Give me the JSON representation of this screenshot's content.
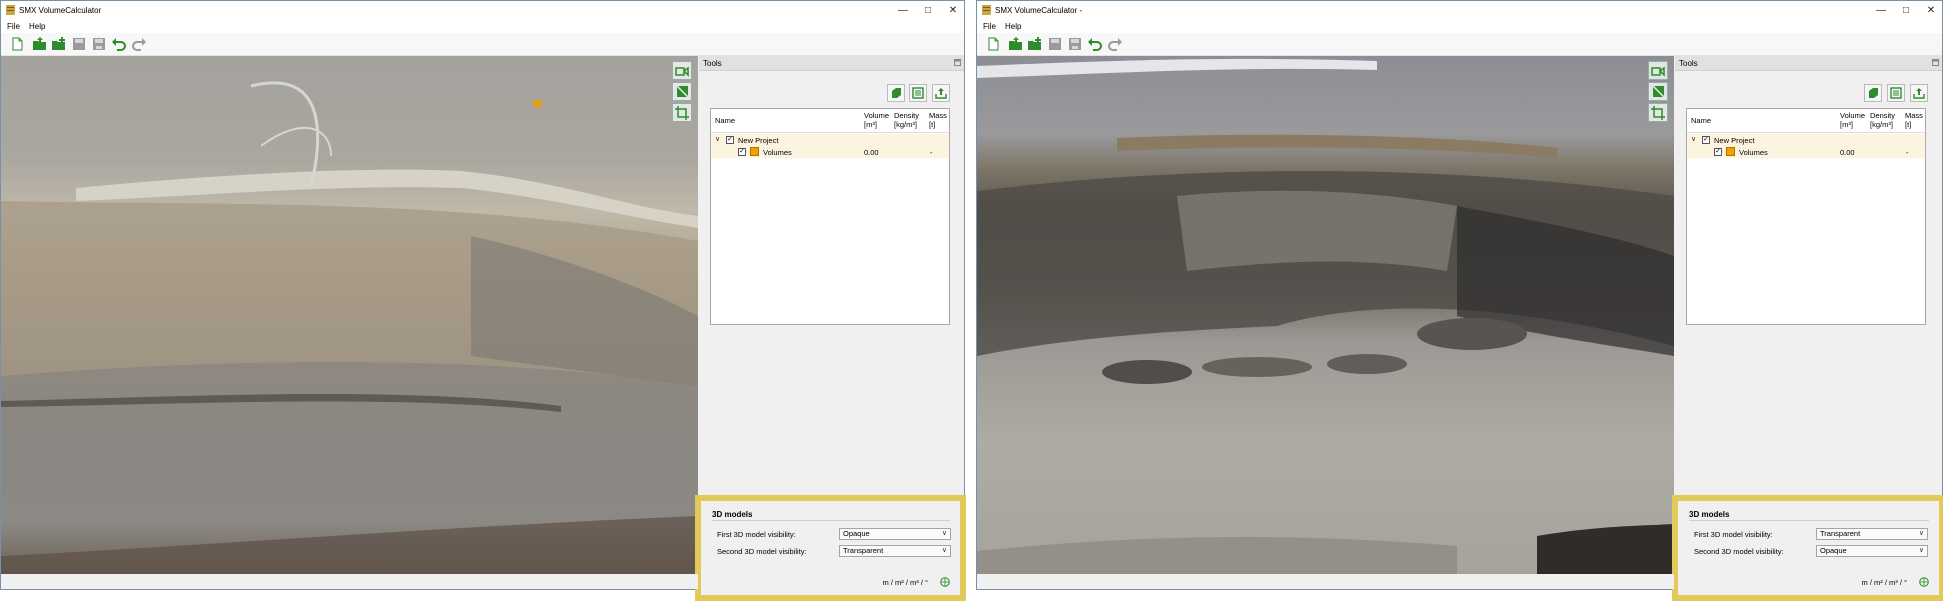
{
  "colors": {
    "accent_green": "#2e8b2e",
    "highlight_border": "#e1c95a",
    "row_highlight": "#fdf3e1",
    "volume_swatch": "#f2a000"
  },
  "windows": [
    {
      "title": "SMX VolumeCalculator",
      "menu": [
        "File",
        "Help"
      ],
      "toolbar_icons": [
        "new-file-icon",
        "open-folder-icon",
        "open-folder-add-icon",
        "save-icon",
        "save-as-icon",
        "undo-icon",
        "redo-icon"
      ],
      "viewport_tools": [
        "camera-icon",
        "orthographic-view-icon",
        "crop-icon"
      ],
      "tools_panel": {
        "title": "Tools",
        "action_icons": [
          "add-volume-icon",
          "report-icon",
          "export-icon"
        ],
        "columns": {
          "name": "Name",
          "volume": "Volume",
          "volume_unit": "[m³]",
          "density": "Density",
          "density_unit": "[kg/m³]",
          "mass": "Mass",
          "mass_unit": "[t]"
        },
        "project": {
          "name": "New Project",
          "checked": "✓"
        },
        "volumes": {
          "name": "Volumes",
          "volume": "0.00",
          "mass": "-",
          "checked": "✓"
        }
      },
      "models": {
        "group_title": "3D models",
        "first_label": "First 3D model visibility:",
        "first_value": "Opaque",
        "second_label": "Second 3D model visibility:",
        "second_value": "Transparent"
      },
      "units": "m / m² / m³ / °"
    },
    {
      "title": "SMX VolumeCalculator -",
      "menu": [
        "File",
        "Help"
      ],
      "toolbar_icons": [
        "new-file-icon",
        "open-folder-icon",
        "open-folder-add-icon",
        "save-icon",
        "save-as-icon",
        "undo-icon",
        "redo-icon"
      ],
      "viewport_tools": [
        "camera-icon",
        "orthographic-view-icon",
        "crop-icon"
      ],
      "tools_panel": {
        "title": "Tools",
        "action_icons": [
          "add-volume-icon",
          "report-icon",
          "export-icon"
        ],
        "columns": {
          "name": "Name",
          "volume": "Volume",
          "volume_unit": "[m³]",
          "density": "Density",
          "density_unit": "[kg/m³]",
          "mass": "Mass",
          "mass_unit": "[t]"
        },
        "project": {
          "name": "New Project",
          "checked": "✓"
        },
        "volumes": {
          "name": "Volumes",
          "volume": "0.00",
          "mass": "-",
          "checked": "✓"
        }
      },
      "models": {
        "group_title": "3D models",
        "first_label": "First 3D model visibility:",
        "first_value": "Transparent",
        "second_label": "Second 3D model visibility:",
        "second_value": "Opaque"
      },
      "units": "m / m² / m³ / °"
    }
  ]
}
